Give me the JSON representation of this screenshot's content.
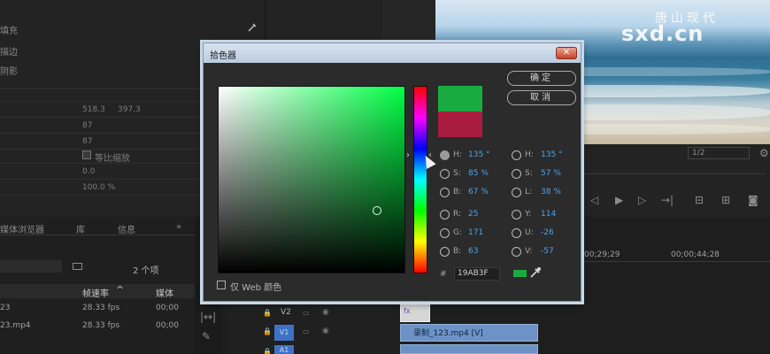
{
  "effect_controls": {
    "fill_label": "填充",
    "stroke_label": "描边",
    "shadow_label": "阴影",
    "position_x": "518.3",
    "position_y": "397.3",
    "scale_value": "87",
    "scale_width_value": "87",
    "uniform_scale_label": "等比缩放",
    "rotation_value": "0.0",
    "opacity_value": "100.0 %"
  },
  "project_panel": {
    "tab_media_browser": "媒体浏览器",
    "tab_library": "库",
    "tab_info": "信息",
    "more_symbol": "»",
    "item_count": "2 个项",
    "col_frame_rate": "帧速率",
    "col_media": "媒体",
    "rows": [
      {
        "name": "23",
        "fps": "28.33 fps",
        "media": "00;00"
      },
      {
        "name": "23.mp4",
        "fps": "28.33 fps",
        "media": "00;00"
      }
    ]
  },
  "program_monitor": {
    "timecode_left": "00;29;29",
    "timecode_right": "00;00;44;28",
    "resolution_label": "1/2"
  },
  "timeline": {
    "track_v2": "V2",
    "track_v1": "V1",
    "track_a1": "A1",
    "clip_fx": "fx",
    "clip_video_label": "录制_123.mp4 [V]"
  },
  "watermark": {
    "top_text": "唐山现代",
    "brand_text": "sxd.cn"
  },
  "color_picker": {
    "title": "拾色器",
    "close_symbol": "✕",
    "ok_label": "确定",
    "cancel_label": "取消",
    "web_colors_label": "仅 Web 颜色",
    "hex_label": "#",
    "hex_value": "19AB3F",
    "hsb": {
      "h_label": "H:",
      "h_value": "135 °",
      "s_label": "S:",
      "s_value": "85 %",
      "b_label": "B:",
      "b_value": "67 %"
    },
    "rgb": {
      "r_label": "R:",
      "r_value": "25",
      "g_label": "G:",
      "g_value": "171",
      "b_label": "B:",
      "b_value": "63"
    },
    "hsl": {
      "h_label": "H:",
      "h_value": "135 °",
      "s_label": "S:",
      "s_value": "57 %",
      "l_label": "L:",
      "l_value": "38 %"
    },
    "yuv": {
      "y_label": "Y:",
      "y_value": "114",
      "u_label": "U:",
      "u_value": "-26",
      "v_label": "V:",
      "v_value": "-57"
    },
    "colors": {
      "new_color": "#19AB3F",
      "original_color": "#A81D3F"
    }
  }
}
